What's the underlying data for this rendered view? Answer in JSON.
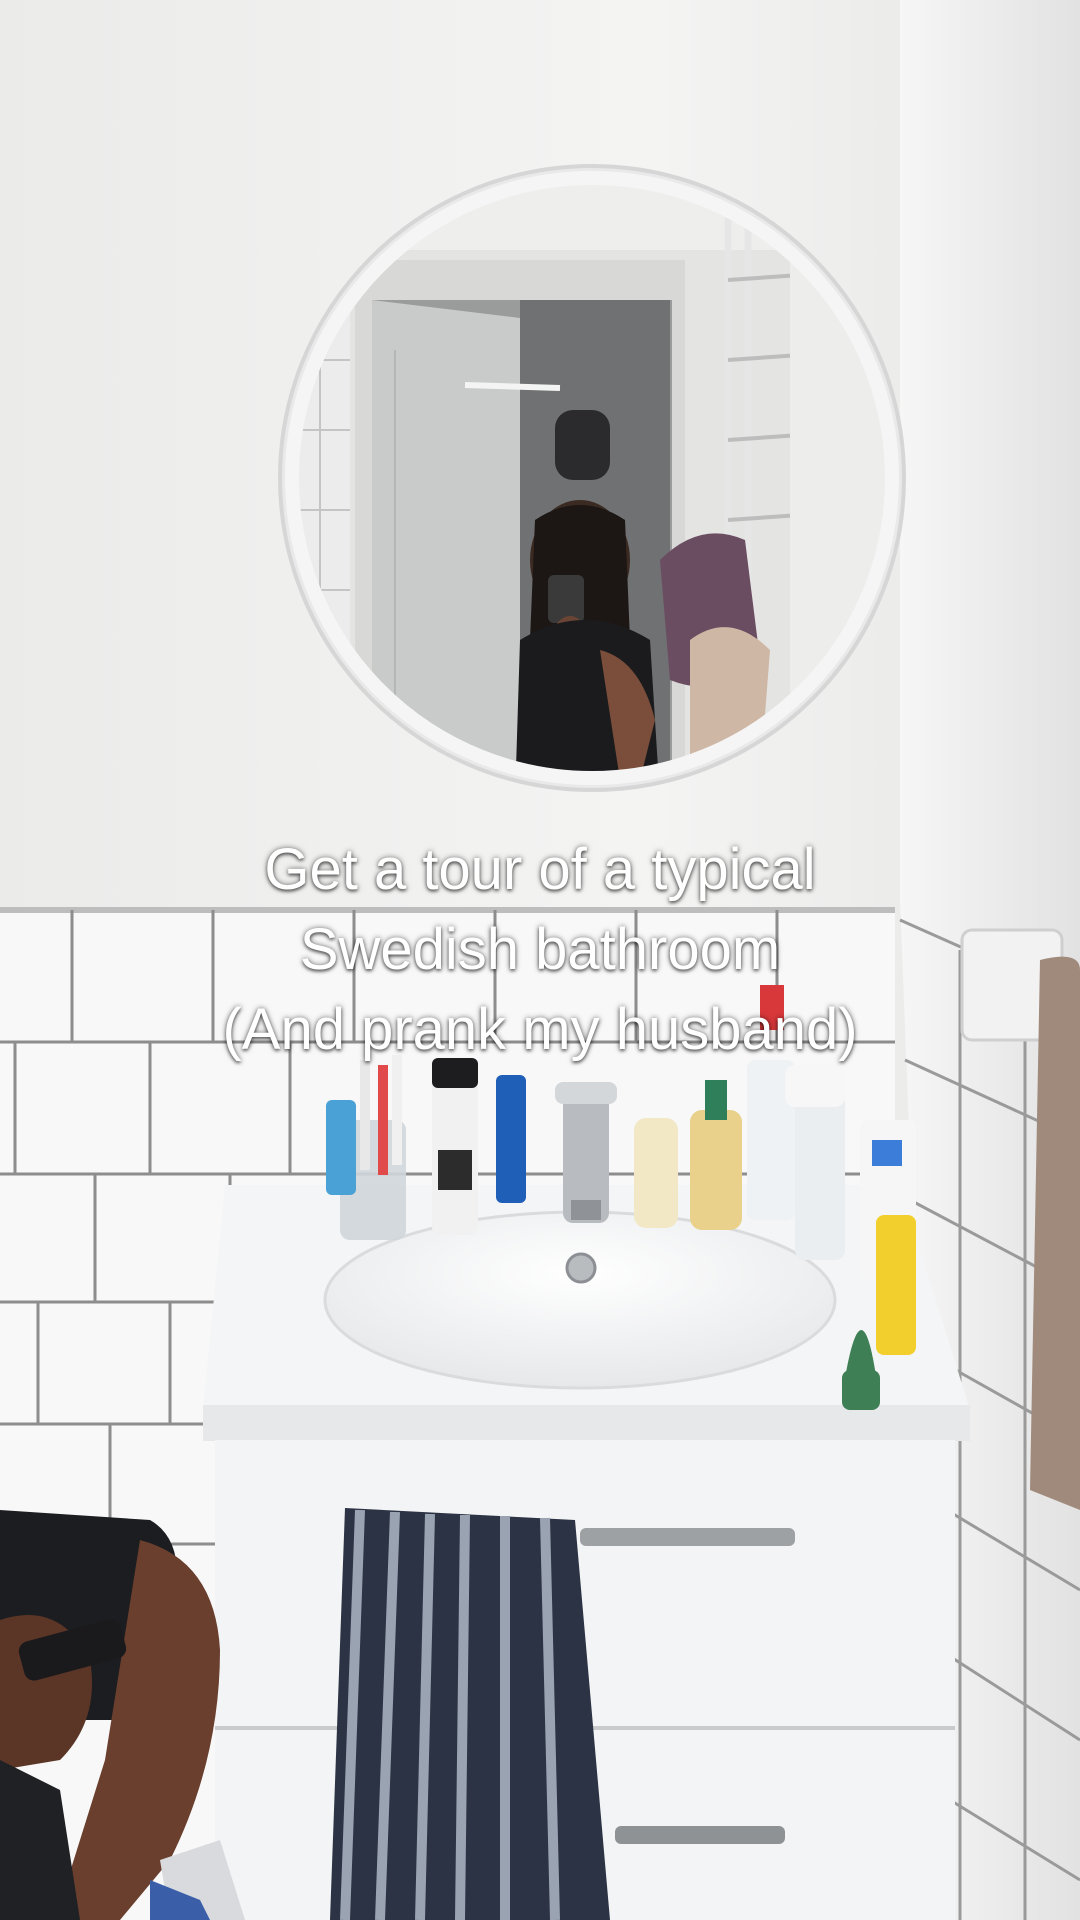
{
  "caption": {
    "line1": "Get a tour of a typical",
    "line2": "Swedish bathroom",
    "line3": "(And prank my husband)"
  },
  "colors": {
    "wall": "#f1f1f0",
    "tile": "#fafafa",
    "grout": "#8e8e8e",
    "vanity": "#f7f7f7",
    "towel_dark": "#2a3142",
    "towel_light": "#9aa2b0",
    "caption_text": "#ffffff"
  }
}
